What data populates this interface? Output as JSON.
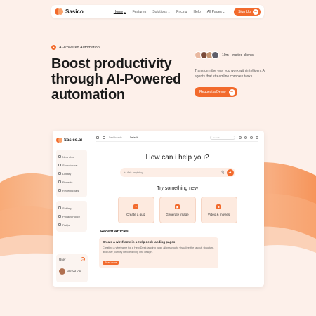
{
  "nav": {
    "brand": "Sasico",
    "links": [
      {
        "label": "Home",
        "has_dropdown": true,
        "active": true
      },
      {
        "label": "Features",
        "has_dropdown": false
      },
      {
        "label": "Solutions",
        "has_dropdown": true
      },
      {
        "label": "Pricing",
        "has_dropdown": false
      },
      {
        "label": "Help",
        "has_dropdown": false
      },
      {
        "label": "All Pages",
        "has_dropdown": true
      }
    ],
    "signup_label": "Sign Up",
    "chevron": "⌄",
    "arrow": "➜"
  },
  "hero": {
    "badge_label": "AI-Powered Automation",
    "title": "Boost productivity through AI-Powered automation",
    "trusted_label": "10m+ trusted clients",
    "description": "Transform the way you work with intelligent AI agents that streamline complex tasks.",
    "cta_label": "Request a Demo",
    "avatar_colors": [
      "#e9b8a0",
      "#7a4b3a",
      "#c59572",
      "#5e5e6a"
    ]
  },
  "app": {
    "brand": "Sasico.ai",
    "sidebar_items": [
      "New chat",
      "Search chat",
      "Library",
      "Projects",
      "Recent chats"
    ],
    "sidebar_bottom_items": [
      "Setting",
      "Privacy Policy",
      "FAQs"
    ],
    "user_section_label": "User",
    "user_plus": "+",
    "user_name": "Michel jon",
    "breadcrumb_root": "Dashboards",
    "breadcrumb_sep": "/",
    "breadcrumb_current": "Default",
    "search_placeholder": "Search",
    "heading": "How can i help you?",
    "ask_placeholder": "Ask anything",
    "mic": "🎙",
    "send": "➜",
    "try_heading": "Try something new",
    "cards": [
      {
        "label": "Create a quiz",
        "icon": "quiz-icon",
        "glyph": "?"
      },
      {
        "label": "Generate image",
        "icon": "image-icon",
        "glyph": "▣"
      },
      {
        "label": "Video & movies",
        "icon": "video-icon",
        "glyph": "▶"
      }
    ],
    "recent_heading": "Recent Articles",
    "article": {
      "title": "Create a wireframe in a Help desk landing pages",
      "description": "Creating a wireframe for a Help Desk landing page allows you to visualize the layout, structure, and user journey before diving into design.",
      "button_label": "Read more"
    }
  },
  "colors": {
    "accent": "#f26a2c",
    "accent_light": "#fdeee6",
    "background": "#fdf0ea"
  }
}
